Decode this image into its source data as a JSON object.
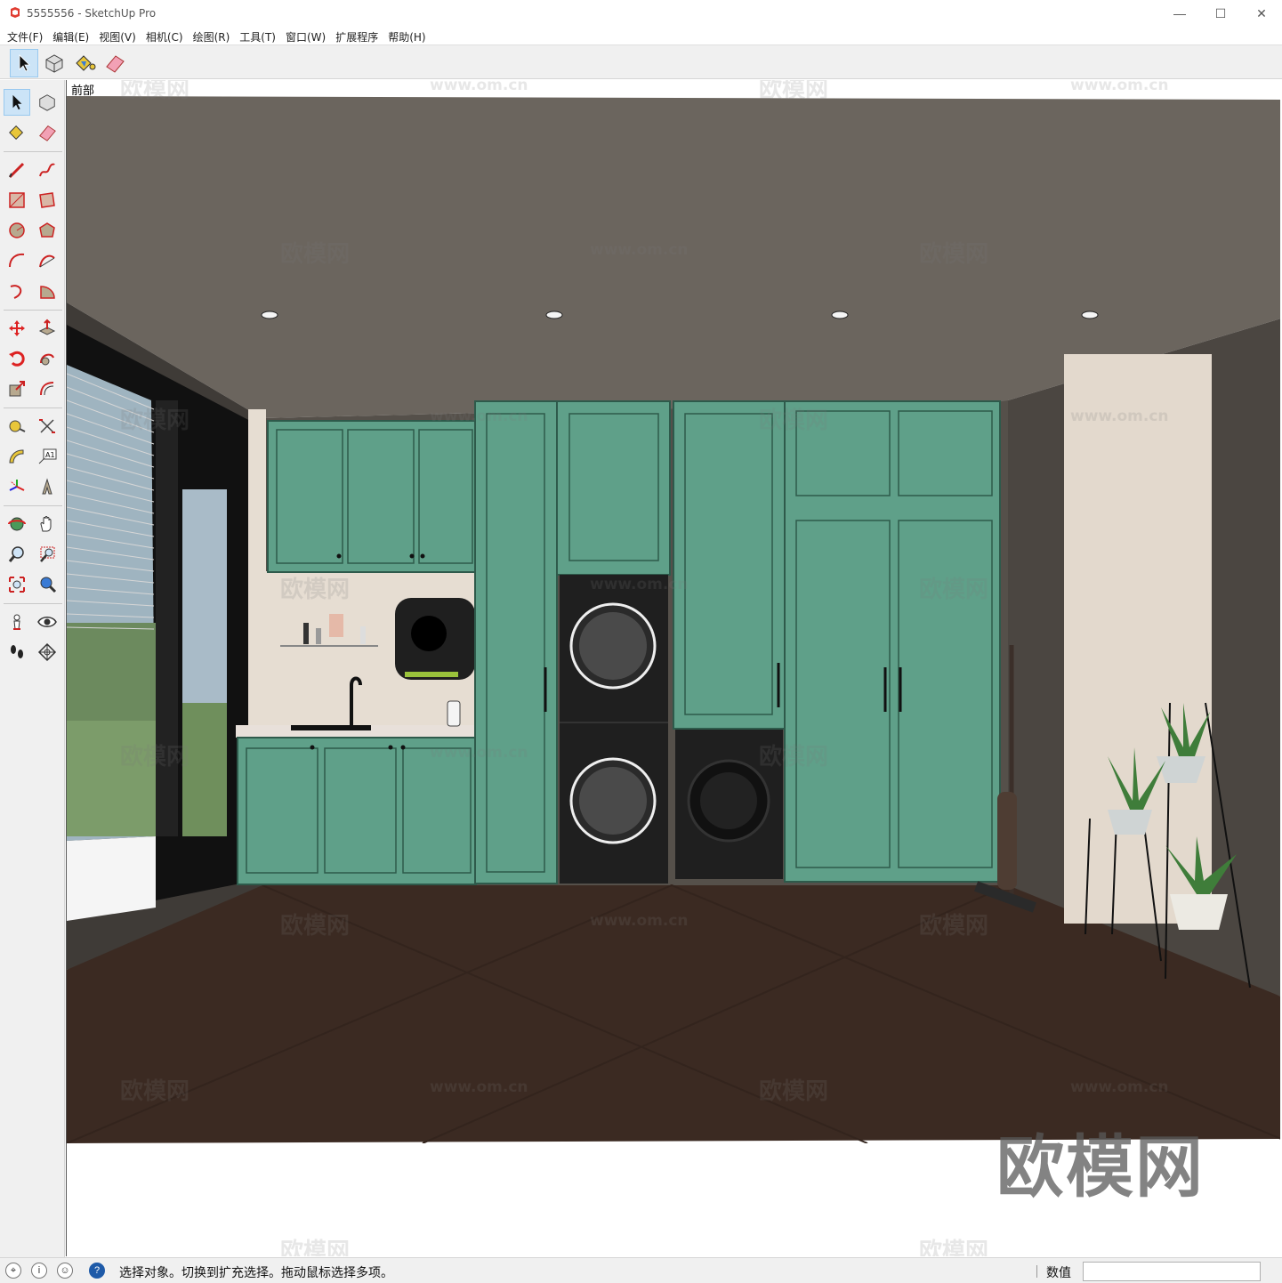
{
  "window": {
    "title": "5555556 - SketchUp Pro",
    "minimize_glyph": "—",
    "maximize_glyph": "☐",
    "close_glyph": "✕"
  },
  "menu": [
    "文件(F)",
    "编辑(E)",
    "视图(V)",
    "相机(C)",
    "绘图(R)",
    "工具(T)",
    "窗口(W)",
    "扩展程序",
    "帮助(H)"
  ],
  "toolbar_top": [
    {
      "name": "select-tool",
      "icon": "arrow-cursor-icon",
      "active": true
    },
    {
      "name": "make-component-tool",
      "icon": "component-icon",
      "active": false
    },
    {
      "name": "paint-bucket-tool",
      "icon": "paint-bucket-icon",
      "active": false
    },
    {
      "name": "eraser-tool",
      "icon": "eraser-icon",
      "active": false
    }
  ],
  "toolbar_left": [
    "select-tool",
    "make-component-tool",
    "paint-bucket-tool",
    "eraser-tool",
    "line-tool",
    "freehand-tool",
    "rectangle-tool",
    "rotated-rectangle-tool",
    "circle-tool",
    "polygon-tool",
    "arc-tool",
    "two-point-arc-tool",
    "three-point-arc-tool",
    "pie-tool",
    "move-tool",
    "push-pull-tool",
    "rotate-tool",
    "follow-me-tool",
    "scale-tool",
    "offset-tool",
    "tape-measure-tool",
    "text-tool",
    "protractor-tool",
    "3d-text-tool",
    "axes-tool",
    "dimension-tool",
    "orbit-tool",
    "pan-tool",
    "zoom-tool",
    "zoom-window-tool",
    "zoom-extents-tool",
    "previous-view-tool",
    "position-camera-tool",
    "look-around-tool",
    "walk-tool",
    "section-plane-tool"
  ],
  "viewport": {
    "scene_tab": "前部",
    "watermark_cn": "欧模网",
    "watermark_url": "www.om.cn",
    "logo_text": "欧模网"
  },
  "colors": {
    "ceiling": "#6b655e",
    "wall": "#4e4944",
    "floor": "#3b2a22",
    "cabinet": "#5fa089",
    "cabinet_line": "#2e5a4b",
    "marble": "#e6ddd2",
    "appliance": "#1f1f1f"
  },
  "statusbar": {
    "icons": [
      "geo-location-icon",
      "credits-icon",
      "user-account-icon",
      "help-icon"
    ],
    "message": "选择对象。切换到扩充选择。拖动鼠标选择多项。",
    "measurements_label": "数值",
    "measurements_value": ""
  }
}
